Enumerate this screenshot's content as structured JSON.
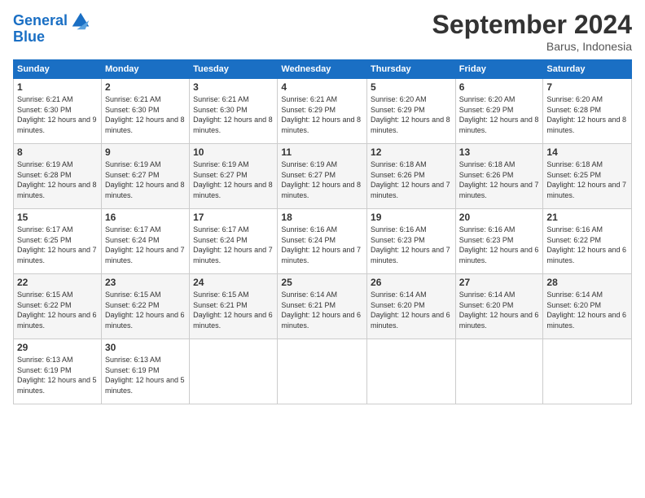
{
  "logo": {
    "line1": "General",
    "line2": "Blue"
  },
  "title": "September 2024",
  "location": "Barus, Indonesia",
  "days_of_week": [
    "Sunday",
    "Monday",
    "Tuesday",
    "Wednesday",
    "Thursday",
    "Friday",
    "Saturday"
  ],
  "weeks": [
    [
      {
        "day": "1",
        "sunrise": "6:21 AM",
        "sunset": "6:30 PM",
        "daylight": "12 hours and 9 minutes."
      },
      {
        "day": "2",
        "sunrise": "6:21 AM",
        "sunset": "6:30 PM",
        "daylight": "12 hours and 8 minutes."
      },
      {
        "day": "3",
        "sunrise": "6:21 AM",
        "sunset": "6:30 PM",
        "daylight": "12 hours and 8 minutes."
      },
      {
        "day": "4",
        "sunrise": "6:21 AM",
        "sunset": "6:29 PM",
        "daylight": "12 hours and 8 minutes."
      },
      {
        "day": "5",
        "sunrise": "6:20 AM",
        "sunset": "6:29 PM",
        "daylight": "12 hours and 8 minutes."
      },
      {
        "day": "6",
        "sunrise": "6:20 AM",
        "sunset": "6:29 PM",
        "daylight": "12 hours and 8 minutes."
      },
      {
        "day": "7",
        "sunrise": "6:20 AM",
        "sunset": "6:28 PM",
        "daylight": "12 hours and 8 minutes."
      }
    ],
    [
      {
        "day": "8",
        "sunrise": "6:19 AM",
        "sunset": "6:28 PM",
        "daylight": "12 hours and 8 minutes."
      },
      {
        "day": "9",
        "sunrise": "6:19 AM",
        "sunset": "6:27 PM",
        "daylight": "12 hours and 8 minutes."
      },
      {
        "day": "10",
        "sunrise": "6:19 AM",
        "sunset": "6:27 PM",
        "daylight": "12 hours and 8 minutes."
      },
      {
        "day": "11",
        "sunrise": "6:19 AM",
        "sunset": "6:27 PM",
        "daylight": "12 hours and 8 minutes."
      },
      {
        "day": "12",
        "sunrise": "6:18 AM",
        "sunset": "6:26 PM",
        "daylight": "12 hours and 7 minutes."
      },
      {
        "day": "13",
        "sunrise": "6:18 AM",
        "sunset": "6:26 PM",
        "daylight": "12 hours and 7 minutes."
      },
      {
        "day": "14",
        "sunrise": "6:18 AM",
        "sunset": "6:25 PM",
        "daylight": "12 hours and 7 minutes."
      }
    ],
    [
      {
        "day": "15",
        "sunrise": "6:17 AM",
        "sunset": "6:25 PM",
        "daylight": "12 hours and 7 minutes."
      },
      {
        "day": "16",
        "sunrise": "6:17 AM",
        "sunset": "6:24 PM",
        "daylight": "12 hours and 7 minutes."
      },
      {
        "day": "17",
        "sunrise": "6:17 AM",
        "sunset": "6:24 PM",
        "daylight": "12 hours and 7 minutes."
      },
      {
        "day": "18",
        "sunrise": "6:16 AM",
        "sunset": "6:24 PM",
        "daylight": "12 hours and 7 minutes."
      },
      {
        "day": "19",
        "sunrise": "6:16 AM",
        "sunset": "6:23 PM",
        "daylight": "12 hours and 7 minutes."
      },
      {
        "day": "20",
        "sunrise": "6:16 AM",
        "sunset": "6:23 PM",
        "daylight": "12 hours and 6 minutes."
      },
      {
        "day": "21",
        "sunrise": "6:16 AM",
        "sunset": "6:22 PM",
        "daylight": "12 hours and 6 minutes."
      }
    ],
    [
      {
        "day": "22",
        "sunrise": "6:15 AM",
        "sunset": "6:22 PM",
        "daylight": "12 hours and 6 minutes."
      },
      {
        "day": "23",
        "sunrise": "6:15 AM",
        "sunset": "6:22 PM",
        "daylight": "12 hours and 6 minutes."
      },
      {
        "day": "24",
        "sunrise": "6:15 AM",
        "sunset": "6:21 PM",
        "daylight": "12 hours and 6 minutes."
      },
      {
        "day": "25",
        "sunrise": "6:14 AM",
        "sunset": "6:21 PM",
        "daylight": "12 hours and 6 minutes."
      },
      {
        "day": "26",
        "sunrise": "6:14 AM",
        "sunset": "6:20 PM",
        "daylight": "12 hours and 6 minutes."
      },
      {
        "day": "27",
        "sunrise": "6:14 AM",
        "sunset": "6:20 PM",
        "daylight": "12 hours and 6 minutes."
      },
      {
        "day": "28",
        "sunrise": "6:14 AM",
        "sunset": "6:20 PM",
        "daylight": "12 hours and 6 minutes."
      }
    ],
    [
      {
        "day": "29",
        "sunrise": "6:13 AM",
        "sunset": "6:19 PM",
        "daylight": "12 hours and 5 minutes."
      },
      {
        "day": "30",
        "sunrise": "6:13 AM",
        "sunset": "6:19 PM",
        "daylight": "12 hours and 5 minutes."
      },
      null,
      null,
      null,
      null,
      null
    ]
  ]
}
